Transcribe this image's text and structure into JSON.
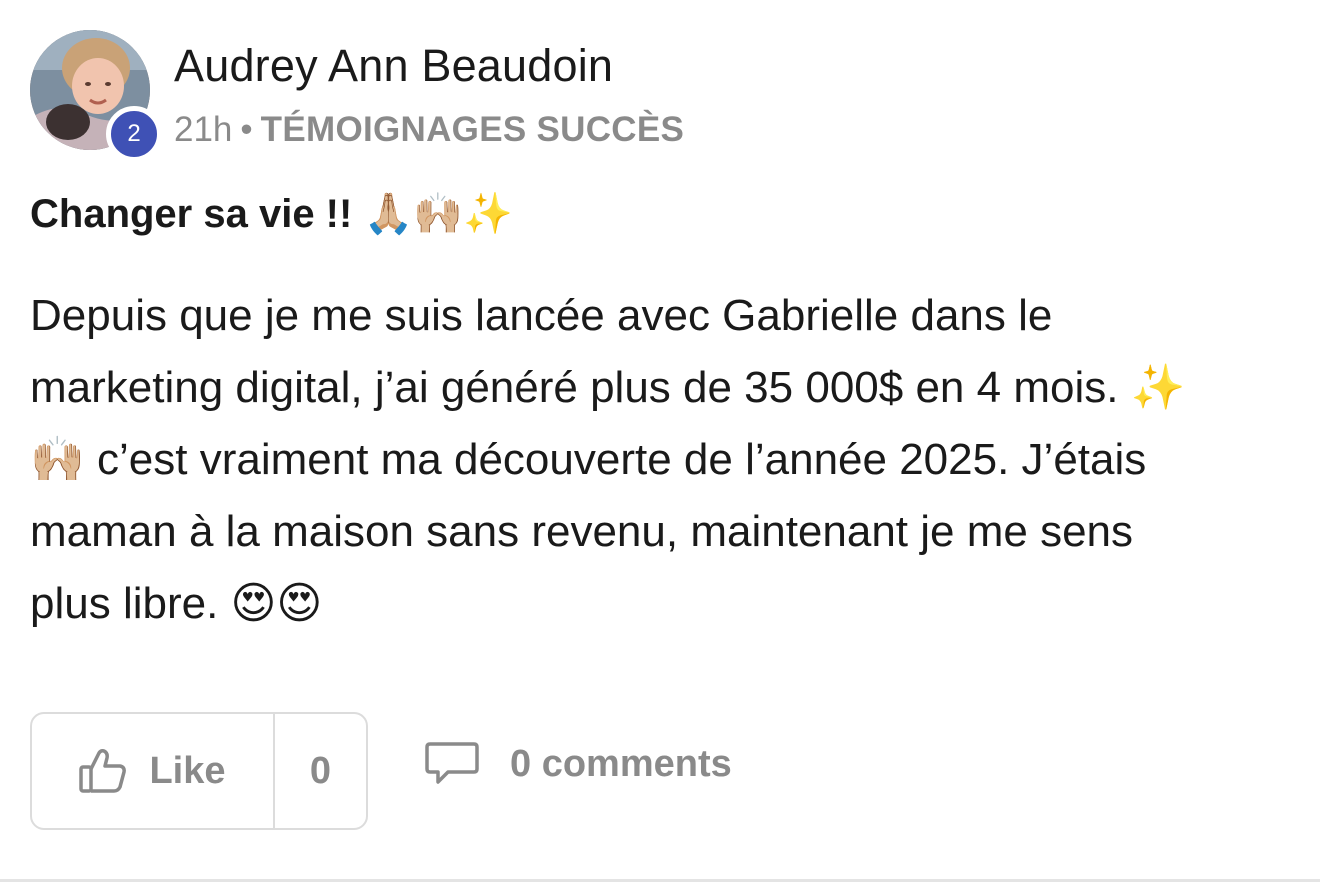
{
  "post": {
    "author": {
      "name": "Audrey Ann Beaudoin",
      "avatar_icon": "user-avatar",
      "level_badge": "2"
    },
    "meta": {
      "time": "21h",
      "separator": "•",
      "category": "TÉMOIGNAGES SUCCÈS"
    },
    "title": "Changer sa vie !! 🙏🏼🙌🏼✨",
    "body_lines": [
      "Depuis que je me suis lancée avec Gabrielle dans le",
      "marketing digital, j’ai généré plus de 35 000$ en 4 mois. ✨",
      "🙌🏼 c’est vraiment ma découverte de l’année 2025. J’étais",
      "maman à la maison sans revenu, maintenant je me sens",
      "plus libre. 😍😍"
    ],
    "actions": {
      "like_label": "Like",
      "like_count": "0",
      "comments_label": "0 comments",
      "like_icon": "thumbs-up-icon",
      "comment_icon": "comment-bubble-icon"
    }
  },
  "colors": {
    "badge": "#3f51b5",
    "text": "#1a1a1a",
    "muted": "#8a8a8a",
    "border": "#dcdcdc"
  }
}
